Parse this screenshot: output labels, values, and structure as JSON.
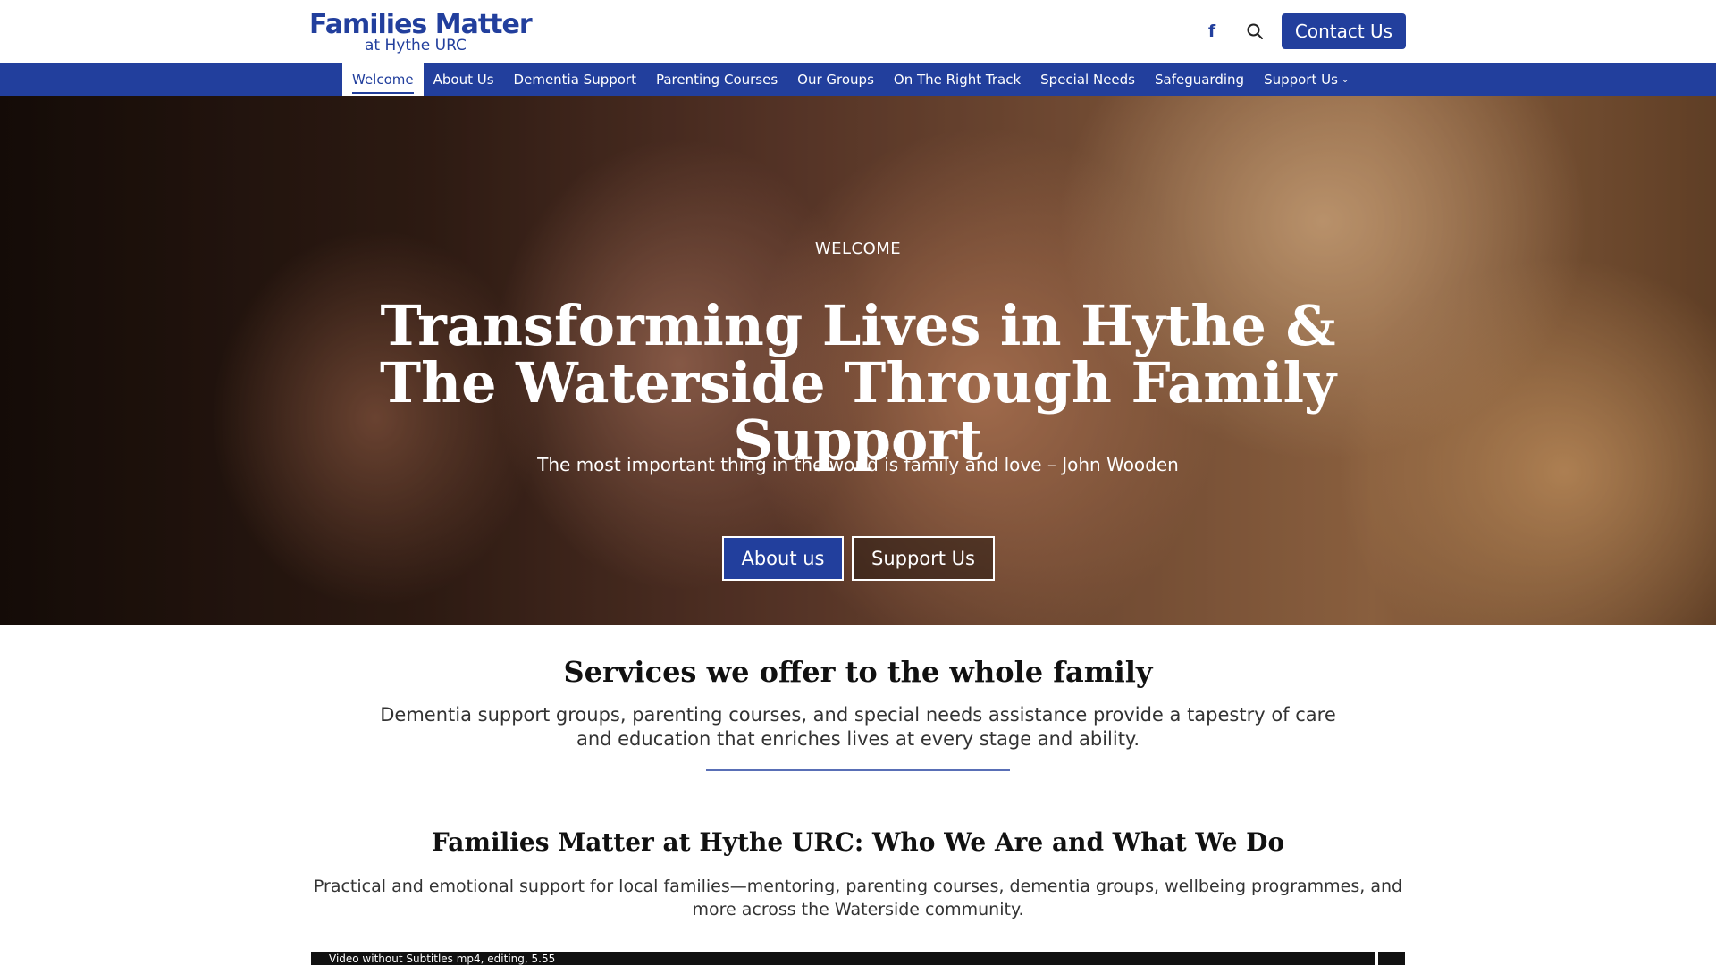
{
  "header": {
    "logo_main": "Families Matter",
    "logo_sub": "at Hythe URC",
    "facebook_icon": "f",
    "contact_label": "Contact Us"
  },
  "nav": {
    "items": [
      {
        "label": "Welcome",
        "active": true
      },
      {
        "label": "About Us"
      },
      {
        "label": "Dementia Support"
      },
      {
        "label": "Parenting Courses"
      },
      {
        "label": "Our Groups"
      },
      {
        "label": "On The Right Track"
      },
      {
        "label": "Special Needs"
      },
      {
        "label": "Safeguarding"
      },
      {
        "label": "Support Us",
        "dropdown": true
      }
    ],
    "chevron": "⌄"
  },
  "hero": {
    "eyebrow": "WELCOME",
    "title": "Transforming Lives in Hythe & The Waterside Through Family Support",
    "quote": "The most important thing in the world is family and love – John Wooden",
    "btn_about": "About us",
    "btn_support": "Support Us"
  },
  "services": {
    "title": "Services we offer to the whole family",
    "text": "Dementia support groups, parenting courses, and special needs assistance provide a tapestry of care and education that enriches lives at every stage and ability."
  },
  "about": {
    "title": "Families Matter at Hythe URC: Who We Are and What We Do",
    "text": "Practical and emotional support for local families—mentoring, parenting courses, dementia groups, wellbeing programmes, and more across the Waterside community."
  },
  "video": {
    "title": "Video without Subtitles mp4, editing, 5.55"
  },
  "colors": {
    "brand": "#223f9d"
  }
}
